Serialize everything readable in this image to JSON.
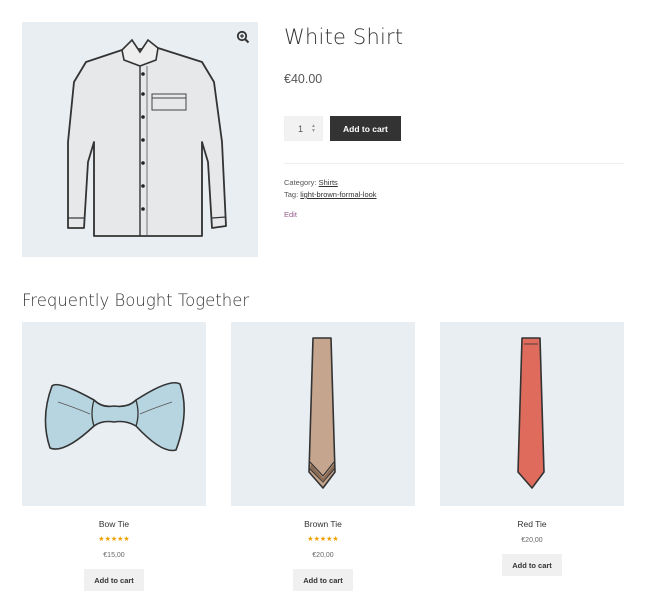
{
  "product": {
    "title": "White Shirt",
    "price": "€40.00",
    "quantity": "1",
    "add_to_cart_label": "Add to cart",
    "meta": {
      "category_label": "Category:",
      "category_value": "Shirts",
      "tag_label": "Tag:",
      "tag_value": "light-brown-formal-look"
    },
    "edit_label": "Edit",
    "image_icon": "zoom-in-icon"
  },
  "related": {
    "heading": "Frequently Bought Together",
    "items": [
      {
        "title": "Bow Tie",
        "rating": 5,
        "stars": "★★★★★",
        "price": "€15,00",
        "button": "Add to cart"
      },
      {
        "title": "Brown Tie",
        "rating": 5,
        "stars": "★★★★★",
        "price": "€20,00",
        "button": "Add to cart"
      },
      {
        "title": "Red Tie",
        "rating": null,
        "stars": "",
        "price": "€20,00",
        "button": "Add to cart"
      }
    ]
  },
  "colors": {
    "primary_button": "#333333",
    "image_background": "#e9eef2",
    "star": "#f0a000",
    "edit_link": "#96588a"
  }
}
